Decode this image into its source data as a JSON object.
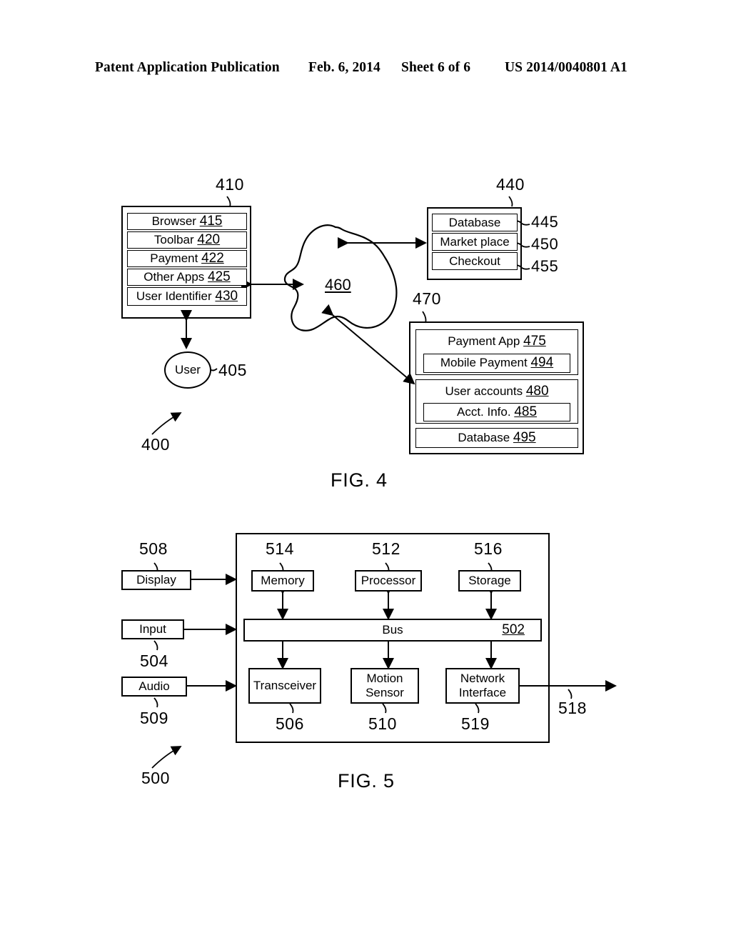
{
  "header": {
    "title": "Patent Application Publication",
    "date": "Feb. 6, 2014",
    "sheet": "Sheet 6 of 6",
    "publication_number": "US 2014/0040801 A1"
  },
  "figure4": {
    "caption": "FIG. 4",
    "system_label": "400",
    "client_device": {
      "label": "410",
      "items": [
        {
          "name": "Browser",
          "ref": "415"
        },
        {
          "name": "Toolbar",
          "ref": "420"
        },
        {
          "name": "Payment",
          "ref": "422"
        },
        {
          "name": "Other Apps",
          "ref": "425"
        },
        {
          "name": "User Identifier",
          "ref": "430"
        }
      ]
    },
    "user": {
      "name": "User",
      "label": "405"
    },
    "network": {
      "label": "460"
    },
    "merchant": {
      "label": "440",
      "items": [
        {
          "name": "Database",
          "ref": "445"
        },
        {
          "name": "Market place",
          "ref": "450"
        },
        {
          "name": "Checkout",
          "ref": "455"
        }
      ]
    },
    "payment_provider": {
      "label": "470",
      "payment_app": {
        "name": "Payment App",
        "ref": "475"
      },
      "mobile_payment": {
        "name": "Mobile Payment",
        "ref": "494"
      },
      "user_accounts": {
        "name": "User accounts",
        "ref": "480"
      },
      "acct_info": {
        "name": "Acct. Info.",
        "ref": "485"
      },
      "database": {
        "name": "Database",
        "ref": "495"
      }
    }
  },
  "figure5": {
    "caption": "FIG. 5",
    "system_label": "500",
    "peripherals": [
      {
        "name": "Display",
        "ref": "508"
      },
      {
        "name": "Input",
        "ref": "504"
      },
      {
        "name": "Audio",
        "ref": "509"
      }
    ],
    "top_components": [
      {
        "name": "Memory",
        "ref": "514"
      },
      {
        "name": "Processor",
        "ref": "512"
      },
      {
        "name": "Storage",
        "ref": "516"
      }
    ],
    "bus": {
      "name": "Bus",
      "ref": "502"
    },
    "bottom_components": [
      {
        "name": "Transceiver",
        "ref": "506"
      },
      {
        "name": "Motion\nSensor",
        "ref": "510",
        "line1": "Motion",
        "line2": "Sensor"
      },
      {
        "name": "Network\nInterface",
        "ref": "519",
        "line1": "Network",
        "line2": "Interface"
      }
    ],
    "external_link": {
      "ref": "518"
    }
  }
}
